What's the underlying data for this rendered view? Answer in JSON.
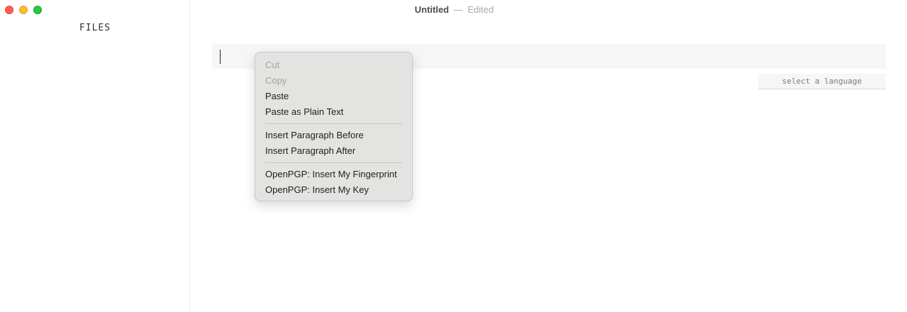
{
  "window": {
    "title": "Untitled",
    "separator": "—",
    "state": "Edited"
  },
  "sidebar": {
    "title": "FILES"
  },
  "editor": {
    "language_placeholder": "select a language"
  },
  "context_menu": {
    "groups": [
      [
        {
          "label": "Cut",
          "enabled": false
        },
        {
          "label": "Copy",
          "enabled": false
        },
        {
          "label": "Paste",
          "enabled": true
        },
        {
          "label": "Paste as Plain Text",
          "enabled": true
        }
      ],
      [
        {
          "label": "Insert Paragraph Before",
          "enabled": true
        },
        {
          "label": "Insert Paragraph After",
          "enabled": true
        }
      ],
      [
        {
          "label": "OpenPGP: Insert My Fingerprint",
          "enabled": true
        },
        {
          "label": "OpenPGP: Insert My Key",
          "enabled": true
        }
      ]
    ]
  },
  "colors": {
    "close": "#ff5f57",
    "minimize": "#febc2e",
    "maximize": "#28c840"
  }
}
